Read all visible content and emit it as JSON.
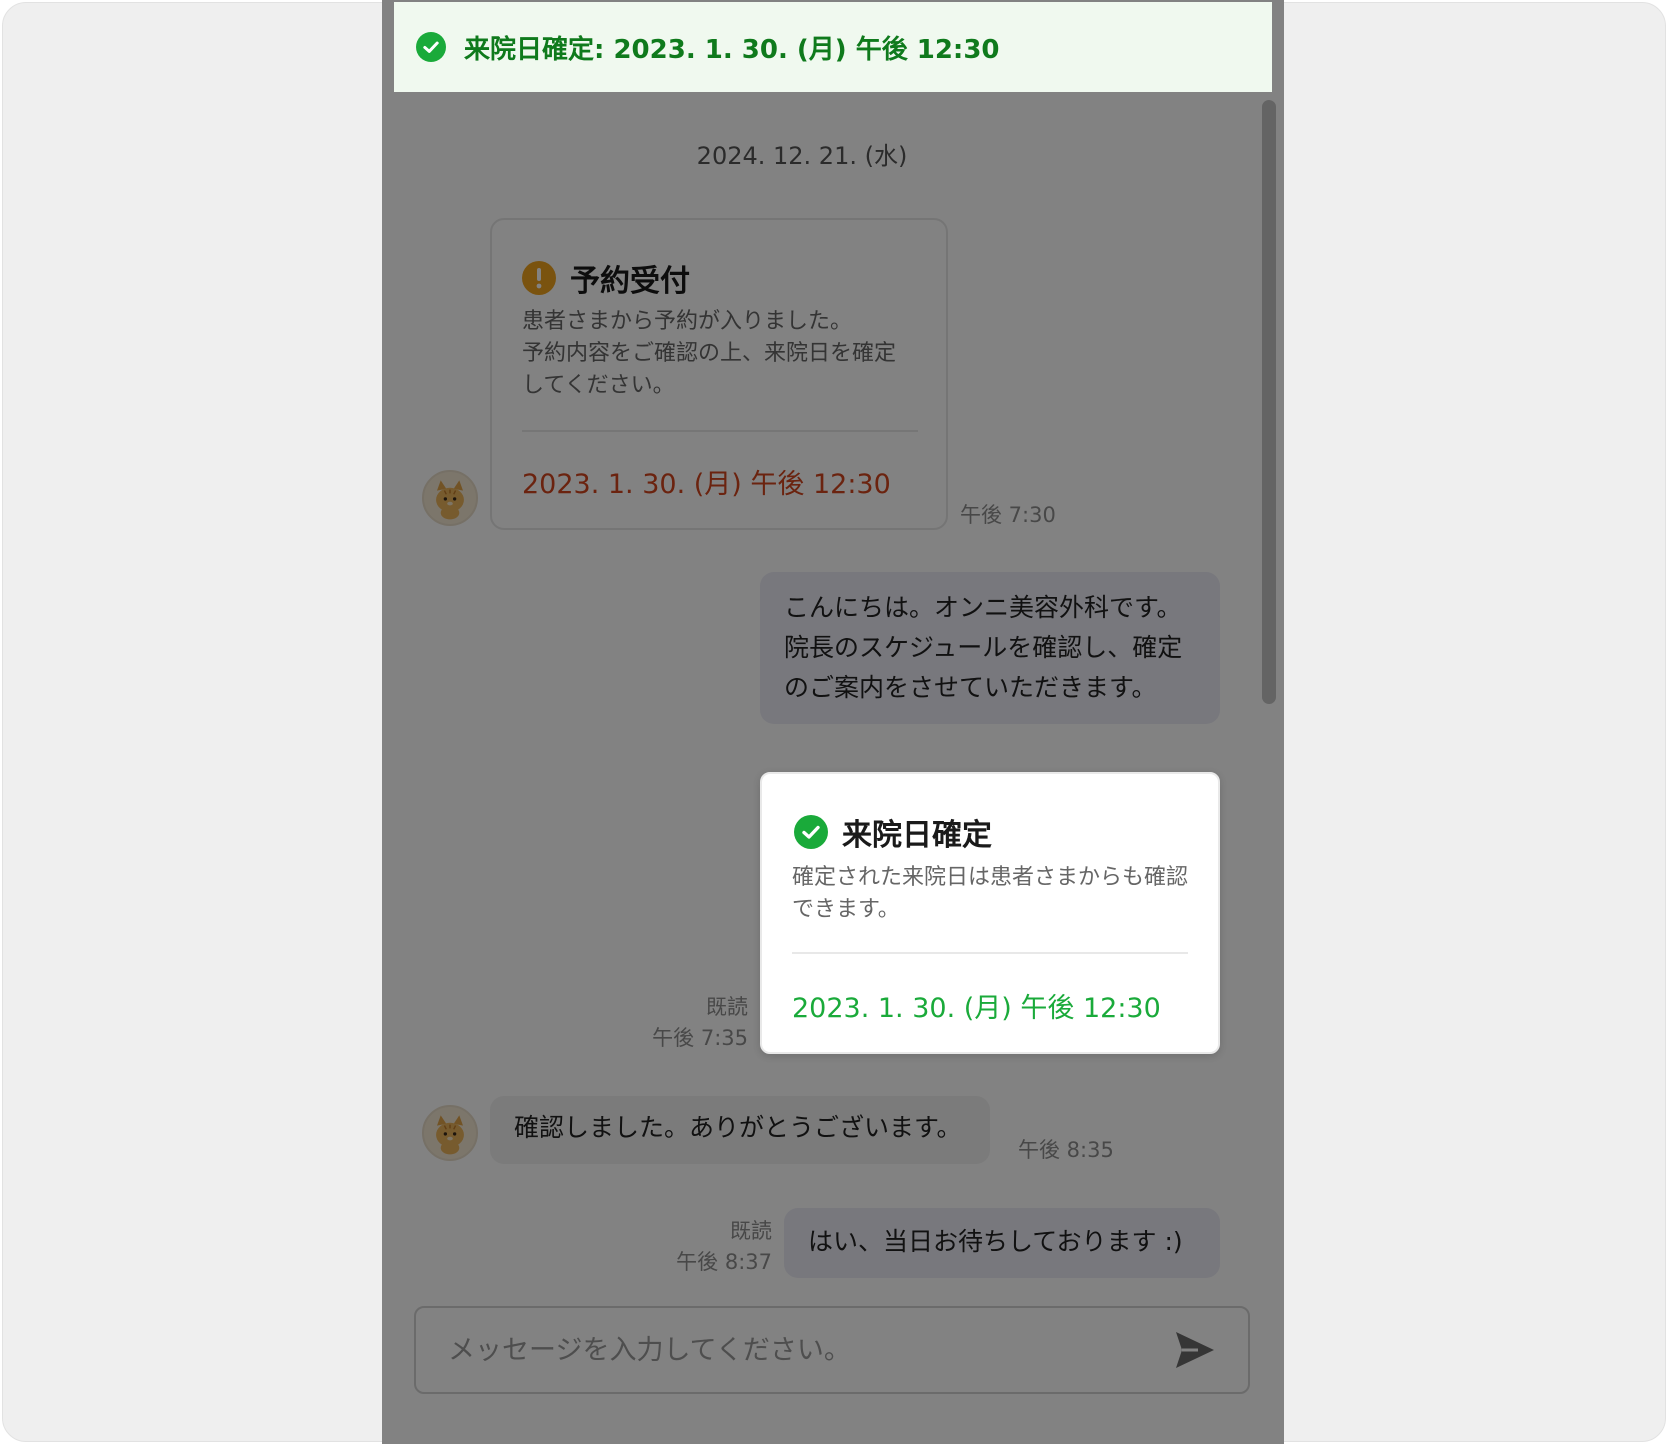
{
  "toast": {
    "text": "来院日確定: 2023. 1. 30. (月) 午後 12:30",
    "icon": "check-circle-icon",
    "color": "#0f7a1c"
  },
  "chat": {
    "date_divider": "2024. 12. 21. (水)",
    "reservation_card": {
      "title": "予約受付",
      "icon": "warning-circle-icon",
      "body": "患者さまから予約が入りました。\n予約内容をご確認の上、来院日を確定\nしてください。",
      "date": "2023. 1. 30. (月) 午後 12:30",
      "time": "午後 7:30",
      "date_color": "#d2461e"
    },
    "clinic_message": {
      "text": "こんにちは。オンニ美容外科です。院長のスケジュールを確認し、確定のご案内をさせていただきます。"
    },
    "confirm_card": {
      "title": "来院日確定",
      "icon": "check-circle-icon",
      "body": "確定された来院日は患者さまからも確認できます。",
      "date": "2023. 1. 30. (月) 午後 12:30",
      "read": "既読",
      "time": "午後 7:35",
      "date_color": "#1aaa3a"
    },
    "patient_message": {
      "text": "確認しました。ありがとうございます。",
      "time": "午後 8:35"
    },
    "clinic_reply": {
      "text": "はい、当日お待ちしております :)",
      "read": "既読",
      "time": "午後 8:37"
    }
  },
  "composer": {
    "placeholder": "メッセージを入力してください。",
    "send_icon": "send-icon"
  }
}
